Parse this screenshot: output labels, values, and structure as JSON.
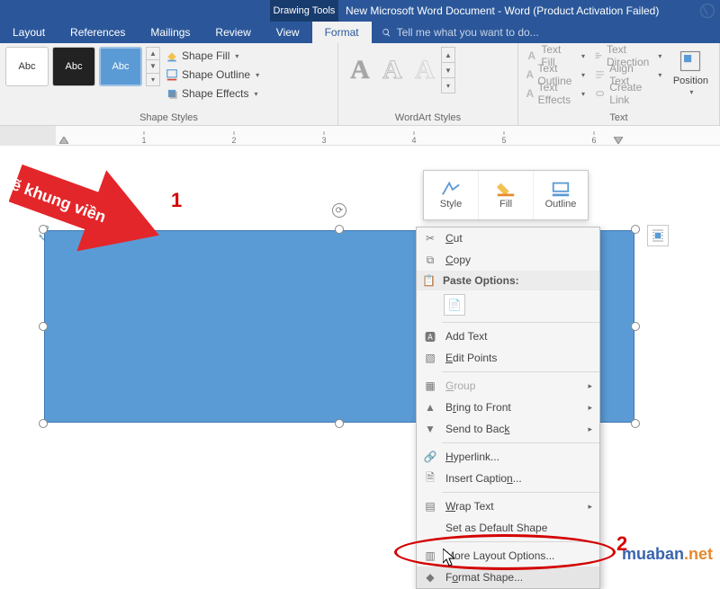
{
  "titlebar": {
    "tools_tab": "Drawing Tools",
    "document_title": "New Microsoft Word Document - Word (Product Activation Failed)"
  },
  "tabs": {
    "items": [
      "Layout",
      "References",
      "Mailings",
      "Review",
      "View",
      "Format"
    ],
    "active_index": 5,
    "tell_me": "Tell me what you want to do..."
  },
  "ribbon": {
    "shape_styles": {
      "label": "Shape Styles",
      "thumbs": [
        "Abc",
        "Abc",
        "Abc"
      ],
      "menu": [
        "Shape Fill",
        "Shape Outline",
        "Shape Effects"
      ]
    },
    "wordart": {
      "label": "WordArt Styles",
      "glyph": "A",
      "menu": [
        "Text Fill",
        "Text Outline",
        "Text Effects"
      ]
    },
    "text": {
      "label": "Text",
      "menu": [
        "Text Direction",
        "Align Text",
        "Create Link"
      ],
      "position": "Position",
      "wrap": "Wrap\nText"
    }
  },
  "ruler": {
    "ticks": [
      "1",
      "2",
      "3",
      "4",
      "5",
      "6"
    ]
  },
  "mini_toolbar": {
    "items": [
      "Style",
      "Fill",
      "Outline"
    ]
  },
  "annotations": {
    "arrow_text": "Vẽ khung viền",
    "num1": "1",
    "num2": "2"
  },
  "context_menu": {
    "cut": "Cut",
    "copy": "Copy",
    "paste_hdr": "Paste Options:",
    "add_text": "Add Text",
    "edit_points": "Edit Points",
    "group": "Group",
    "bring_front": "Bring to Front",
    "send_back": "Send to Back",
    "hyperlink": "Hyperlink...",
    "insert_caption": "Insert Caption...",
    "wrap_text": "Wrap Text",
    "default_shape": "Set as Default Shape",
    "more_layout": "More Layout Options...",
    "format_shape": "Format Shape..."
  },
  "watermark": {
    "a": "muaban",
    "b": ".net"
  }
}
